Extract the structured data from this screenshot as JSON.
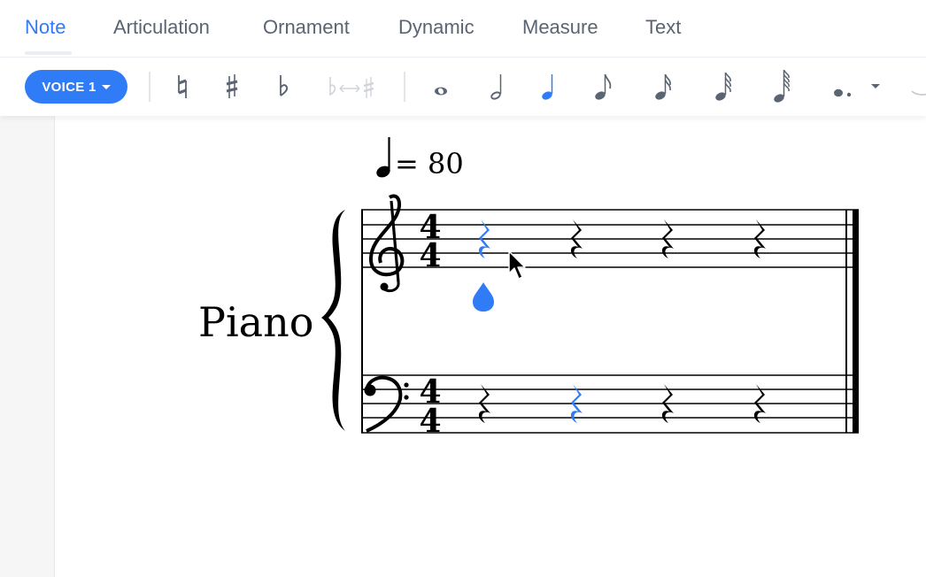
{
  "tabs": [
    {
      "label": "Note",
      "active": true
    },
    {
      "label": "Articulation",
      "active": false
    },
    {
      "label": "Ornament",
      "active": false
    },
    {
      "label": "Dynamic",
      "active": false
    },
    {
      "label": "Measure",
      "active": false
    },
    {
      "label": "Text",
      "active": false
    }
  ],
  "toolbar": {
    "voice_label": "VOICE 1",
    "accidentals": [
      "natural-icon",
      "sharp-icon",
      "flat-icon",
      "enharmonic-swap-icon"
    ],
    "durations": [
      "whole-note-icon",
      "half-note-icon",
      "quarter-note-icon",
      "eighth-note-icon",
      "sixteenth-note-icon",
      "thirty-second-note-icon",
      "sixty-fourth-note-icon",
      "dotted-note-icon"
    ],
    "selected_duration": "quarter-note-icon"
  },
  "score": {
    "tempo_value": "= 80",
    "instrument_name": "Piano",
    "time_signature": {
      "numerator": "4",
      "denominator": "4"
    },
    "treble_rests": [
      "quarter-rest",
      "quarter-rest",
      "quarter-rest",
      "quarter-rest"
    ],
    "bass_rests": [
      "quarter-rest",
      "quarter-rest",
      "quarter-rest",
      "quarter-rest"
    ],
    "selected_treble_index": 0,
    "selected_bass_index": 1
  },
  "colors": {
    "accent": "#2f7cf6",
    "text_muted": "#5b6472",
    "disabled": "#d0d4da",
    "notation": "#000000"
  }
}
